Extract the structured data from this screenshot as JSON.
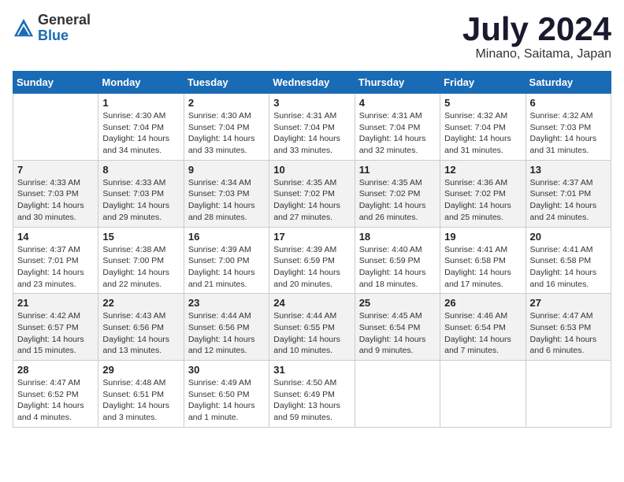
{
  "header": {
    "logo": {
      "general": "General",
      "blue": "Blue"
    },
    "title": "July 2024",
    "location": "Minano, Saitama, Japan"
  },
  "weekdays": [
    "Sunday",
    "Monday",
    "Tuesday",
    "Wednesday",
    "Thursday",
    "Friday",
    "Saturday"
  ],
  "weeks": [
    [
      {
        "day": "",
        "info": ""
      },
      {
        "day": "1",
        "info": "Sunrise: 4:30 AM\nSunset: 7:04 PM\nDaylight: 14 hours\nand 34 minutes."
      },
      {
        "day": "2",
        "info": "Sunrise: 4:30 AM\nSunset: 7:04 PM\nDaylight: 14 hours\nand 33 minutes."
      },
      {
        "day": "3",
        "info": "Sunrise: 4:31 AM\nSunset: 7:04 PM\nDaylight: 14 hours\nand 33 minutes."
      },
      {
        "day": "4",
        "info": "Sunrise: 4:31 AM\nSunset: 7:04 PM\nDaylight: 14 hours\nand 32 minutes."
      },
      {
        "day": "5",
        "info": "Sunrise: 4:32 AM\nSunset: 7:04 PM\nDaylight: 14 hours\nand 31 minutes."
      },
      {
        "day": "6",
        "info": "Sunrise: 4:32 AM\nSunset: 7:03 PM\nDaylight: 14 hours\nand 31 minutes."
      }
    ],
    [
      {
        "day": "7",
        "info": "Sunrise: 4:33 AM\nSunset: 7:03 PM\nDaylight: 14 hours\nand 30 minutes."
      },
      {
        "day": "8",
        "info": "Sunrise: 4:33 AM\nSunset: 7:03 PM\nDaylight: 14 hours\nand 29 minutes."
      },
      {
        "day": "9",
        "info": "Sunrise: 4:34 AM\nSunset: 7:03 PM\nDaylight: 14 hours\nand 28 minutes."
      },
      {
        "day": "10",
        "info": "Sunrise: 4:35 AM\nSunset: 7:02 PM\nDaylight: 14 hours\nand 27 minutes."
      },
      {
        "day": "11",
        "info": "Sunrise: 4:35 AM\nSunset: 7:02 PM\nDaylight: 14 hours\nand 26 minutes."
      },
      {
        "day": "12",
        "info": "Sunrise: 4:36 AM\nSunset: 7:02 PM\nDaylight: 14 hours\nand 25 minutes."
      },
      {
        "day": "13",
        "info": "Sunrise: 4:37 AM\nSunset: 7:01 PM\nDaylight: 14 hours\nand 24 minutes."
      }
    ],
    [
      {
        "day": "14",
        "info": "Sunrise: 4:37 AM\nSunset: 7:01 PM\nDaylight: 14 hours\nand 23 minutes."
      },
      {
        "day": "15",
        "info": "Sunrise: 4:38 AM\nSunset: 7:00 PM\nDaylight: 14 hours\nand 22 minutes."
      },
      {
        "day": "16",
        "info": "Sunrise: 4:39 AM\nSunset: 7:00 PM\nDaylight: 14 hours\nand 21 minutes."
      },
      {
        "day": "17",
        "info": "Sunrise: 4:39 AM\nSunset: 6:59 PM\nDaylight: 14 hours\nand 20 minutes."
      },
      {
        "day": "18",
        "info": "Sunrise: 4:40 AM\nSunset: 6:59 PM\nDaylight: 14 hours\nand 18 minutes."
      },
      {
        "day": "19",
        "info": "Sunrise: 4:41 AM\nSunset: 6:58 PM\nDaylight: 14 hours\nand 17 minutes."
      },
      {
        "day": "20",
        "info": "Sunrise: 4:41 AM\nSunset: 6:58 PM\nDaylight: 14 hours\nand 16 minutes."
      }
    ],
    [
      {
        "day": "21",
        "info": "Sunrise: 4:42 AM\nSunset: 6:57 PM\nDaylight: 14 hours\nand 15 minutes."
      },
      {
        "day": "22",
        "info": "Sunrise: 4:43 AM\nSunset: 6:56 PM\nDaylight: 14 hours\nand 13 minutes."
      },
      {
        "day": "23",
        "info": "Sunrise: 4:44 AM\nSunset: 6:56 PM\nDaylight: 14 hours\nand 12 minutes."
      },
      {
        "day": "24",
        "info": "Sunrise: 4:44 AM\nSunset: 6:55 PM\nDaylight: 14 hours\nand 10 minutes."
      },
      {
        "day": "25",
        "info": "Sunrise: 4:45 AM\nSunset: 6:54 PM\nDaylight: 14 hours\nand 9 minutes."
      },
      {
        "day": "26",
        "info": "Sunrise: 4:46 AM\nSunset: 6:54 PM\nDaylight: 14 hours\nand 7 minutes."
      },
      {
        "day": "27",
        "info": "Sunrise: 4:47 AM\nSunset: 6:53 PM\nDaylight: 14 hours\nand 6 minutes."
      }
    ],
    [
      {
        "day": "28",
        "info": "Sunrise: 4:47 AM\nSunset: 6:52 PM\nDaylight: 14 hours\nand 4 minutes."
      },
      {
        "day": "29",
        "info": "Sunrise: 4:48 AM\nSunset: 6:51 PM\nDaylight: 14 hours\nand 3 minutes."
      },
      {
        "day": "30",
        "info": "Sunrise: 4:49 AM\nSunset: 6:50 PM\nDaylight: 14 hours\nand 1 minute."
      },
      {
        "day": "31",
        "info": "Sunrise: 4:50 AM\nSunset: 6:49 PM\nDaylight: 13 hours\nand 59 minutes."
      },
      {
        "day": "",
        "info": ""
      },
      {
        "day": "",
        "info": ""
      },
      {
        "day": "",
        "info": ""
      }
    ]
  ]
}
